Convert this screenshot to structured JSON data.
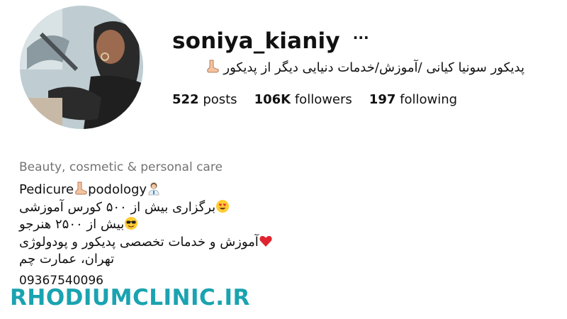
{
  "profile": {
    "username": "soniya_kianiy",
    "more_label": "···",
    "full_name": "پدیکور سونیا کیانی /آموزش/خدمات دنیایی دیگر از پدیکور",
    "stats": [
      {
        "count": "522",
        "label": "posts"
      },
      {
        "count": "106K",
        "label": "followers"
      },
      {
        "count": "197",
        "label": "following"
      }
    ],
    "category": "Beauty, cosmetic & personal care",
    "bio": {
      "line1_a": "Pedicure",
      "line1_b": "podology",
      "line2": "برگزاری بیش از ۵۰۰ کورس آموزشی",
      "line3": "بیش از ۲۵۰۰ هنرجو",
      "line4": "آموزش و خدمات تخصصی پدیکور و پودولوژی",
      "line5": "تهران، عمارت چم"
    },
    "phone": "09367540096"
  },
  "watermark": "RHODIUMCLINIC.IR",
  "icons": {
    "foot": "foot-icon",
    "health_worker": "health-worker-icon",
    "heart_eyes": "heart-eyes-emoji",
    "sunglasses": "sunglasses-emoji",
    "red_heart": "red-heart-emoji"
  }
}
